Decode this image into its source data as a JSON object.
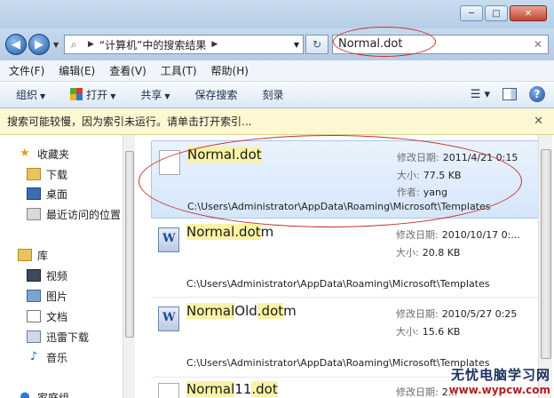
{
  "window": {
    "controls": {
      "minimize": "─",
      "maximize": "□",
      "close": "✕"
    }
  },
  "address": {
    "crumb": "“计算机”中的搜索结果",
    "search_value": "Normal.dot"
  },
  "menu": [
    "文件(F)",
    "编辑(E)",
    "查看(V)",
    "工具(T)",
    "帮助(H)"
  ],
  "commands": {
    "organize": "组织",
    "open": "打开",
    "share": "共享",
    "save_search": "保存搜索",
    "burn": "刻录"
  },
  "infobar": {
    "text": "搜索可能较慢，因为索引未运行。请单击打开索引..."
  },
  "nav": {
    "favorites": "收藏夹",
    "downloads": "下载",
    "desktop": "桌面",
    "recent": "最近访问的位置",
    "libraries": "库",
    "videos": "视频",
    "pictures": "图片",
    "documents": "文档",
    "thunder": "迅雷下载",
    "music": "音乐",
    "homegroup": "家庭组"
  },
  "results": [
    {
      "name_parts": [
        "Normal",
        ".dot"
      ],
      "date_label": "修改日期:",
      "date": "2011/4/21 0:15",
      "size_label": "大小:",
      "size": "77.5 KB",
      "author_label": "作者:",
      "author": "yang",
      "path": "C:\\Users\\Administrator\\AppData\\Roaming\\Microsoft\\Templates"
    },
    {
      "name_parts": [
        "Normal",
        ".dot",
        "m"
      ],
      "date_label": "修改日期:",
      "date": "2010/10/17 0:...",
      "size_label": "大小:",
      "size": "20.8 KB",
      "path": "C:\\Users\\Administrator\\AppData\\Roaming\\Microsoft\\Templates"
    },
    {
      "name_parts": [
        "Normal",
        "Old",
        ".dot",
        "m"
      ],
      "date_label": "修改日期:",
      "date": "2010/5/27 0:25",
      "size_label": "大小:",
      "size": "15.6 KB",
      "path": "C:\\Users\\Administrator\\AppData\\Roaming\\Microsoft\\Templates"
    },
    {
      "name_parts": [
        "Normal",
        "11",
        ".dot"
      ],
      "date_label": "修改日期:",
      "date": "2..."
    }
  ],
  "watermark": {
    "line1": "无忧电脑学习网",
    "line2": "www.wypcw.com"
  }
}
